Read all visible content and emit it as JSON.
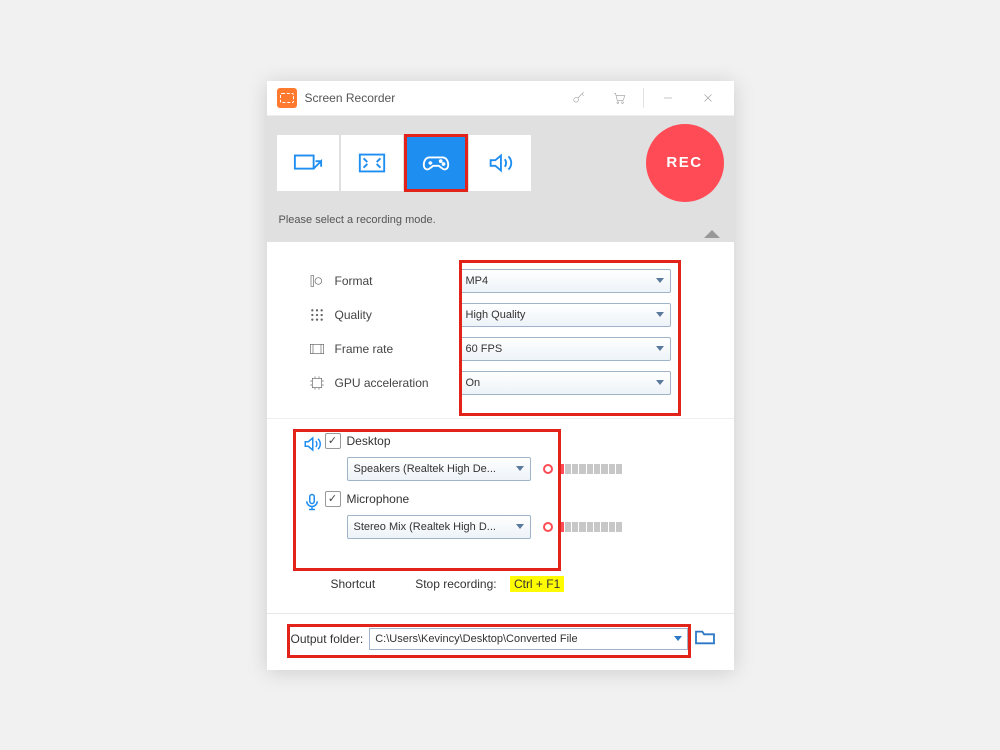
{
  "title": "Screen Recorder",
  "rec_label": "REC",
  "mode_hint": "Please select a recording mode.",
  "settings": {
    "format": {
      "label": "Format",
      "value": "MP4"
    },
    "quality": {
      "label": "Quality",
      "value": "High Quality"
    },
    "framerate": {
      "label": "Frame rate",
      "value": "60 FPS"
    },
    "gpu": {
      "label": "GPU acceleration",
      "value": "On"
    }
  },
  "audio": {
    "desktop": {
      "label": "Desktop",
      "device": "Speakers (Realtek High De..."
    },
    "mic": {
      "label": "Microphone",
      "device": "Stereo Mix (Realtek High D..."
    }
  },
  "shortcut": {
    "label": "Shortcut",
    "stop_label": "Stop recording:",
    "stop_key": "Ctrl + F1"
  },
  "output": {
    "label": "Output folder:",
    "path": "C:\\Users\\Kevincy\\Desktop\\Converted File"
  }
}
